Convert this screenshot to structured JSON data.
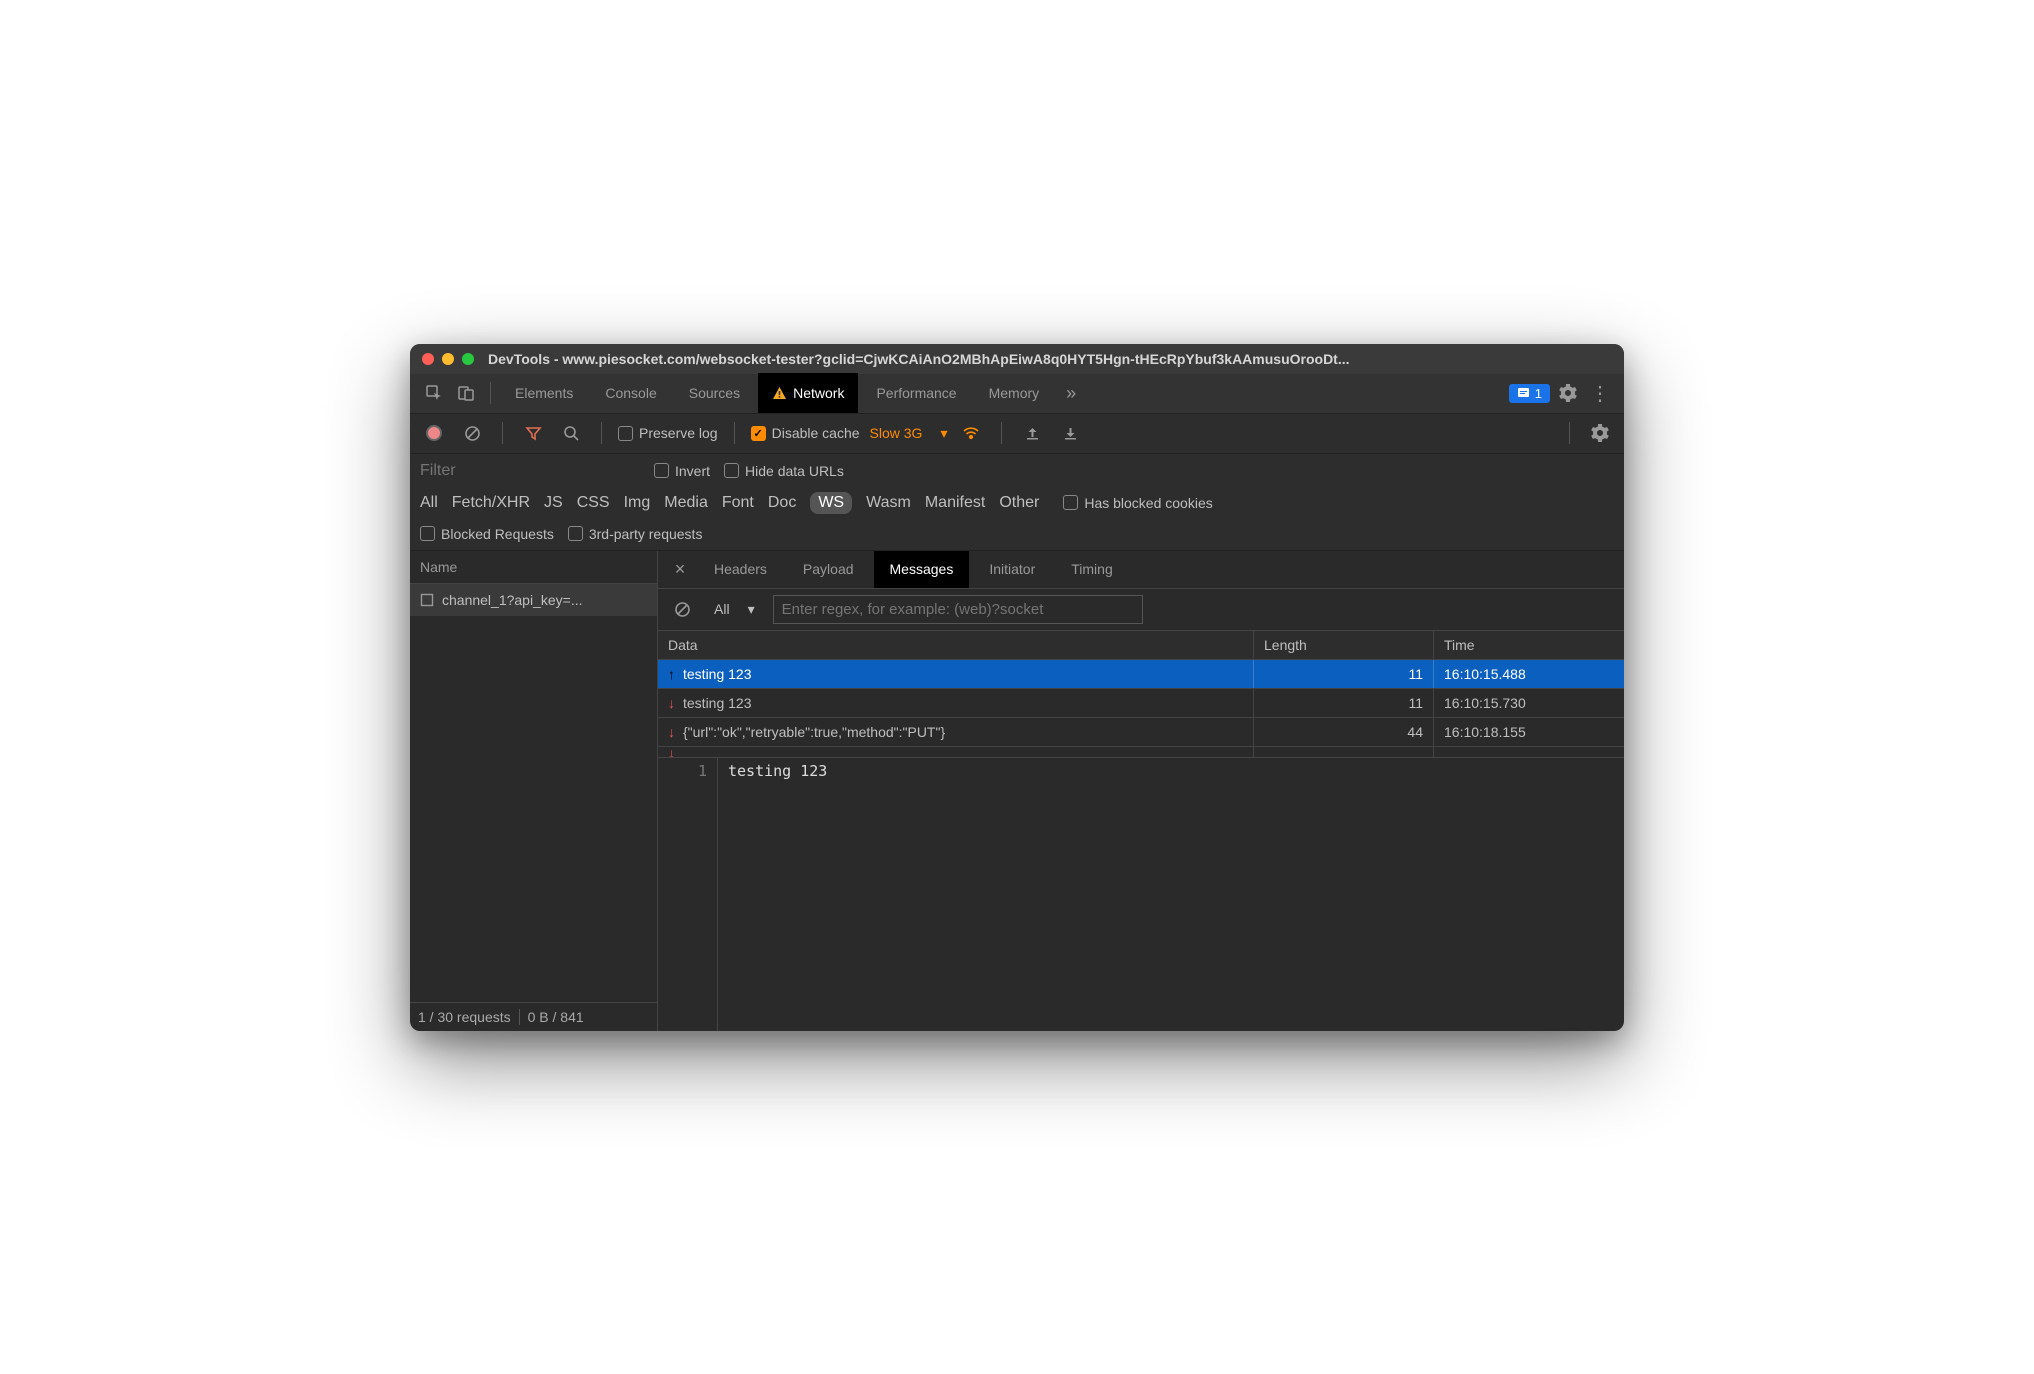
{
  "window": {
    "title": "DevTools - www.piesocket.com/websocket-tester?gclid=CjwKCAiAnO2MBhApEiwA8q0HYT5Hgn-tHEcRpYbuf3kAAmusuOrooDt..."
  },
  "main_tabs": {
    "elements": "Elements",
    "console": "Console",
    "sources": "Sources",
    "network": "Network",
    "performance": "Performance",
    "memory": "Memory"
  },
  "issues_count": "1",
  "network_toolbar": {
    "preserve_log": "Preserve log",
    "disable_cache": "Disable cache",
    "throttling": "Slow 3G"
  },
  "filter": {
    "placeholder": "Filter",
    "invert": "Invert",
    "hide_data_urls": "Hide data URLs",
    "types": {
      "all": "All",
      "fetch": "Fetch/XHR",
      "js": "JS",
      "css": "CSS",
      "img": "Img",
      "media": "Media",
      "font": "Font",
      "doc": "Doc",
      "ws": "WS",
      "wasm": "Wasm",
      "manifest": "Manifest",
      "other": "Other"
    },
    "has_blocked": "Has blocked cookies",
    "blocked_requests": "Blocked Requests",
    "third_party": "3rd-party requests"
  },
  "requests": {
    "header": "Name",
    "items": [
      "channel_1?api_key=..."
    ],
    "status": {
      "count": "1 / 30 requests",
      "size": "0 B / 841"
    }
  },
  "detail_tabs": {
    "headers": "Headers",
    "payload": "Payload",
    "messages": "Messages",
    "initiator": "Initiator",
    "timing": "Timing"
  },
  "messages": {
    "filter_all": "All",
    "regex_placeholder": "Enter regex, for example: (web)?socket",
    "columns": {
      "data": "Data",
      "length": "Length",
      "time": "Time"
    },
    "rows": [
      {
        "dir": "up",
        "data": "testing 123",
        "length": "11",
        "time": "16:10:15.488",
        "selected": true
      },
      {
        "dir": "down",
        "data": "testing 123",
        "length": "11",
        "time": "16:10:15.730",
        "selected": false
      },
      {
        "dir": "down",
        "data": "{\"url\":\"ok\",\"retryable\":true,\"method\":\"PUT\"}",
        "length": "44",
        "time": "16:10:18.155",
        "selected": false
      }
    ],
    "preview": {
      "line": "1",
      "content": "testing 123"
    }
  }
}
